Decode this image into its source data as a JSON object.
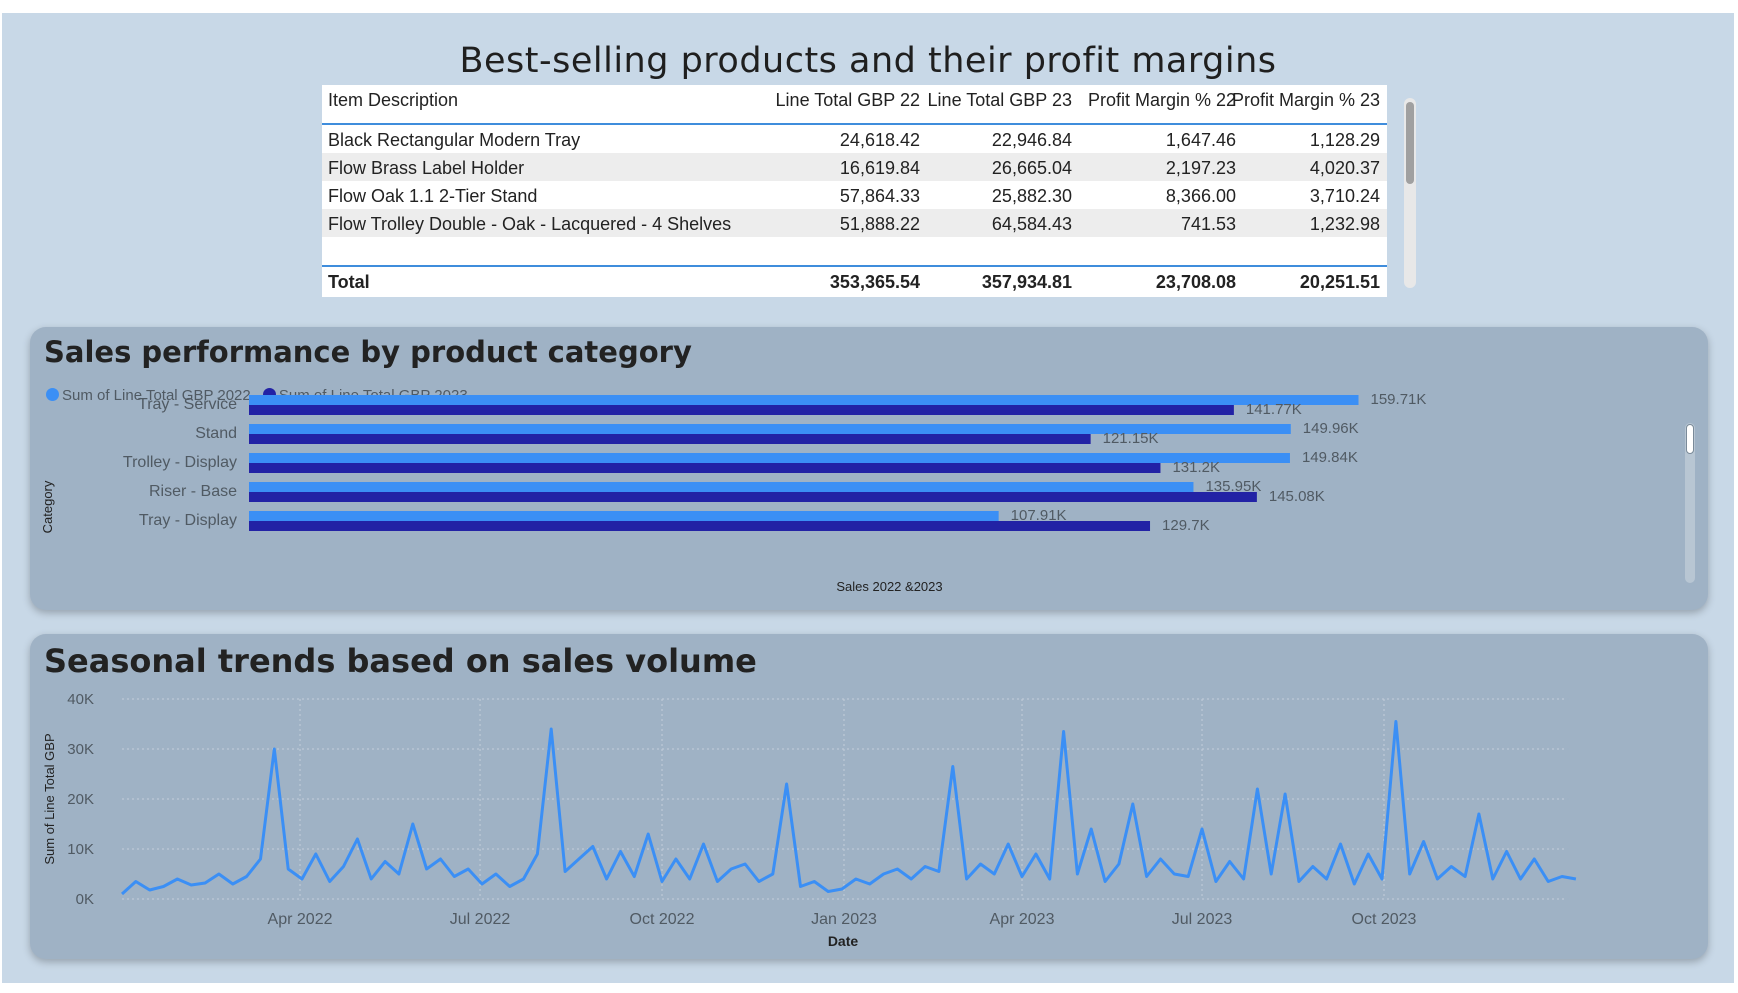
{
  "report": {
    "title": "Best-selling products and their profit margins"
  },
  "table": {
    "columns": [
      "Item Description",
      "Line Total GBP 22",
      "Line Total GBP 23",
      "Profit Margin % 22",
      "Profit Margin % 23"
    ],
    "rows": [
      [
        "Black Rectangular Modern Tray",
        "24,618.42",
        "22,946.84",
        "1,647.46",
        "1,128.29"
      ],
      [
        "Flow Brass Label Holder",
        "16,619.84",
        "26,665.04",
        "2,197.23",
        "4,020.37"
      ],
      [
        "Flow Oak 1.1 2-Tier Stand",
        "57,864.33",
        "25,882.30",
        "8,366.00",
        "3,710.24"
      ],
      [
        "Flow Trolley Double - Oak - Lacquered - 4 Shelves",
        "51,888.22",
        "64,584.43",
        "741.53",
        "1,232.98"
      ]
    ],
    "total": [
      "Total",
      "353,365.54",
      "357,934.81",
      "23,708.08",
      "20,251.51"
    ]
  },
  "chart_data": [
    {
      "type": "bar",
      "orientation": "horizontal",
      "title": "Sales performance by product category",
      "xlabel": "Sales 2022 &2023",
      "ylabel": "Category",
      "categories": [
        "Tray - Service",
        "Stand",
        "Trolley - Display",
        "Riser - Base",
        "Tray - Display"
      ],
      "series": [
        {
          "name": "Sum of Line Total GBP 2022",
          "color": "#3b8ff5",
          "values": [
            159710,
            149960,
            149840,
            135950,
            107910
          ],
          "labels": [
            "159.71K",
            "149.96K",
            "149.84K",
            "135.95K",
            "107.91K"
          ]
        },
        {
          "name": "Sum of Line Total GBP 2023",
          "color": "#2222a5",
          "values": [
            141770,
            121150,
            131200,
            145080,
            129700
          ],
          "labels": [
            "141.77K",
            "121.15K",
            "131.2K",
            "145.08K",
            "129.7K"
          ]
        }
      ],
      "xlim": [
        0,
        170000
      ],
      "legend": "top-left"
    },
    {
      "type": "line",
      "title": "Seasonal trends based on sales volume",
      "xlabel": "Date",
      "ylabel": "Sum of Line Total GBP",
      "color": "#3b8ff5",
      "ylim": [
        0,
        40000
      ],
      "yticks": [
        0,
        10000,
        20000,
        30000,
        40000
      ],
      "ytick_labels": [
        "0K",
        "10K",
        "20K",
        "30K",
        "40K"
      ],
      "xlim": [
        "2022-01-01",
        "2023-12-31"
      ],
      "xticks": [
        "2022-04-01",
        "2022-07-01",
        "2022-10-01",
        "2023-01-01",
        "2023-04-01",
        "2023-07-01",
        "2023-10-01"
      ],
      "xtick_labels": [
        "Apr 2022",
        "Jul 2022",
        "Oct 2022",
        "Jan 2023",
        "Apr 2023",
        "Jul 2023",
        "Oct 2023"
      ],
      "grid": true,
      "series": [
        {
          "name": "Sum of Line Total GBP",
          "x_start": "2022-01-01",
          "step_days": 7,
          "values": [
            1000,
            3500,
            1800,
            2500,
            4000,
            2800,
            3200,
            5000,
            3000,
            4500,
            8000,
            30000,
            6000,
            4000,
            9000,
            3500,
            6500,
            12000,
            4000,
            7500,
            5000,
            15000,
            6000,
            8000,
            4500,
            6000,
            3000,
            5000,
            2500,
            4000,
            9000,
            34000,
            5500,
            8000,
            10500,
            4000,
            9500,
            4500,
            13000,
            3500,
            8000,
            4000,
            11000,
            3500,
            6000,
            7000,
            3500,
            5000,
            23000,
            2500,
            3500,
            1500,
            2000,
            4000,
            3000,
            5000,
            6000,
            4000,
            6500,
            5500,
            26500,
            4000,
            7000,
            5000,
            11000,
            4500,
            9000,
            4000,
            33500,
            5000,
            14000,
            3500,
            7000,
            19000,
            4500,
            8000,
            5000,
            4500,
            14000,
            3500,
            7500,
            4000,
            22000,
            5000,
            21000,
            3500,
            6500,
            4000,
            11000,
            3000,
            9000,
            4000,
            35500,
            5000,
            11500,
            4000,
            6500,
            4500,
            17000,
            4000,
            9500,
            4000,
            8000,
            3500,
            4500,
            4000
          ]
        }
      ],
      "legend": "none"
    }
  ]
}
